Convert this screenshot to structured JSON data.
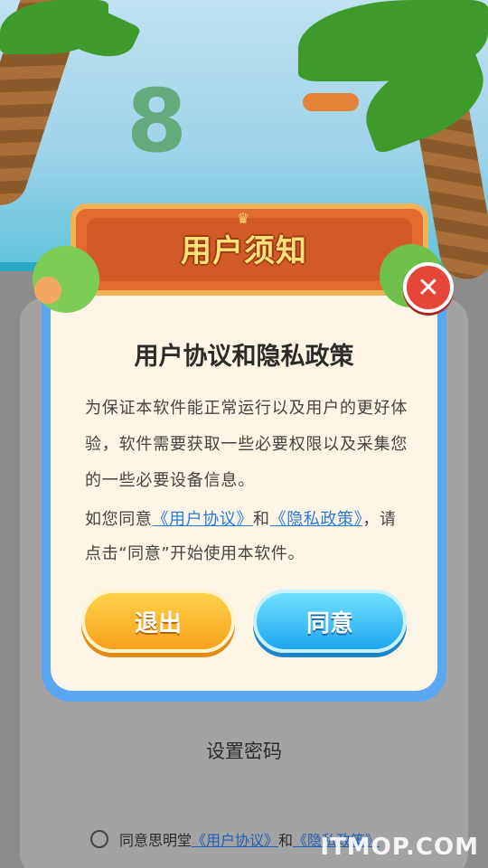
{
  "header": {
    "title": "用户须知"
  },
  "dialog": {
    "title": "用户协议和隐私政策",
    "paragraph1": "为保证本软件能正常运行以及用户的更好体验，软件需要获取一些必要权限以及采集您的一些必要设备信息。",
    "paragraph2_prefix": "如您同意",
    "link_user_agreement": "《用户协议》",
    "and_text": "和",
    "link_privacy_policy": "《隐私政策》",
    "paragraph2_suffix": "，请点击“同意”开始使用本软件。",
    "exit_label": "退出",
    "agree_label": "同意",
    "close_icon": "close-icon"
  },
  "background": {
    "set_password": "设置密码",
    "consent_prefix": "同意思明堂",
    "consent_user_agreement": "《用户协议》",
    "consent_and": "和",
    "consent_privacy_policy": "《隐私政策》"
  },
  "watermark": "ITMOP.COM",
  "colors": {
    "accent_blue": "#2a7bd8",
    "exit_button": "#f7a21c",
    "agree_button": "#1fa6ef",
    "close_button": "#e6463a",
    "card_border": "#5aa6f0"
  }
}
